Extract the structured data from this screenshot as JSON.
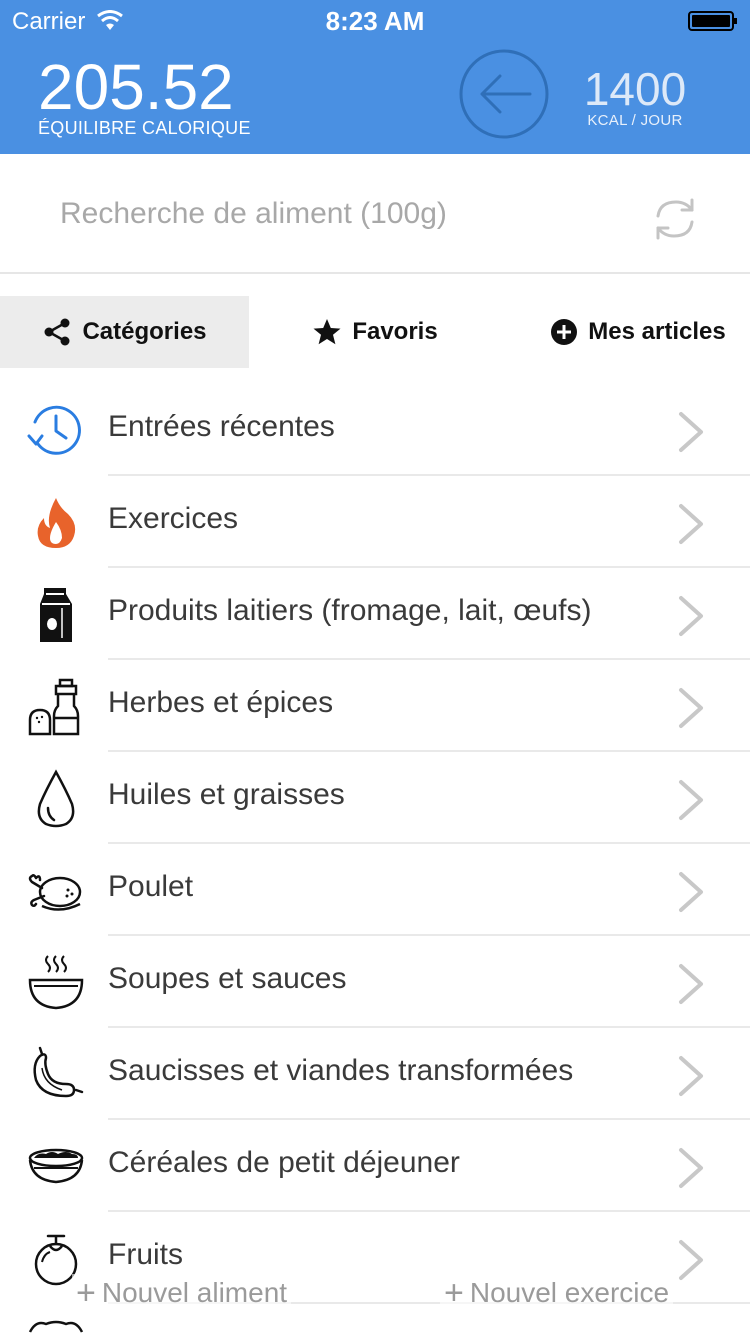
{
  "status_bar": {
    "carrier": "Carrier",
    "time": "8:23 AM"
  },
  "summary": {
    "balance_value": "205.52",
    "balance_label": "ÉQUILIBRE CALORIQUE",
    "target_value": "1400",
    "target_label": "KCAL / JOUR"
  },
  "search": {
    "placeholder": "Recherche de aliment (100g)"
  },
  "tabs": [
    {
      "label": "Catégories",
      "icon": "share-icon",
      "active": true
    },
    {
      "label": "Favoris",
      "icon": "star-icon",
      "active": false
    },
    {
      "label": "Mes articles",
      "icon": "plus-circle-icon",
      "active": false
    }
  ],
  "categories": [
    {
      "label": "Entrées récentes",
      "icon": "clock-history-icon"
    },
    {
      "label": "Exercices",
      "icon": "flame-icon"
    },
    {
      "label": "Produits laitiers (fromage, lait, œufs)",
      "icon": "milk-carton-icon"
    },
    {
      "label": "Herbes et épices",
      "icon": "spice-shaker-icon"
    },
    {
      "label": "Huiles et graisses",
      "icon": "oil-drop-icon"
    },
    {
      "label": "Poulet",
      "icon": "roast-chicken-icon"
    },
    {
      "label": "Soupes et sauces",
      "icon": "soup-bowl-icon"
    },
    {
      "label": "Saucisses et viandes transformées",
      "icon": "sausage-icon"
    },
    {
      "label": "Céréales de petit déjeuner",
      "icon": "cereal-bowl-icon"
    },
    {
      "label": "Fruits",
      "icon": "fruit-icon"
    }
  ],
  "bottom_actions": {
    "new_food": "Nouvel aliment",
    "new_exercise": "Nouvel exercice"
  },
  "colors": {
    "header": "#4a90e2",
    "flame": "#e8632b",
    "recent": "#2a7de1"
  }
}
